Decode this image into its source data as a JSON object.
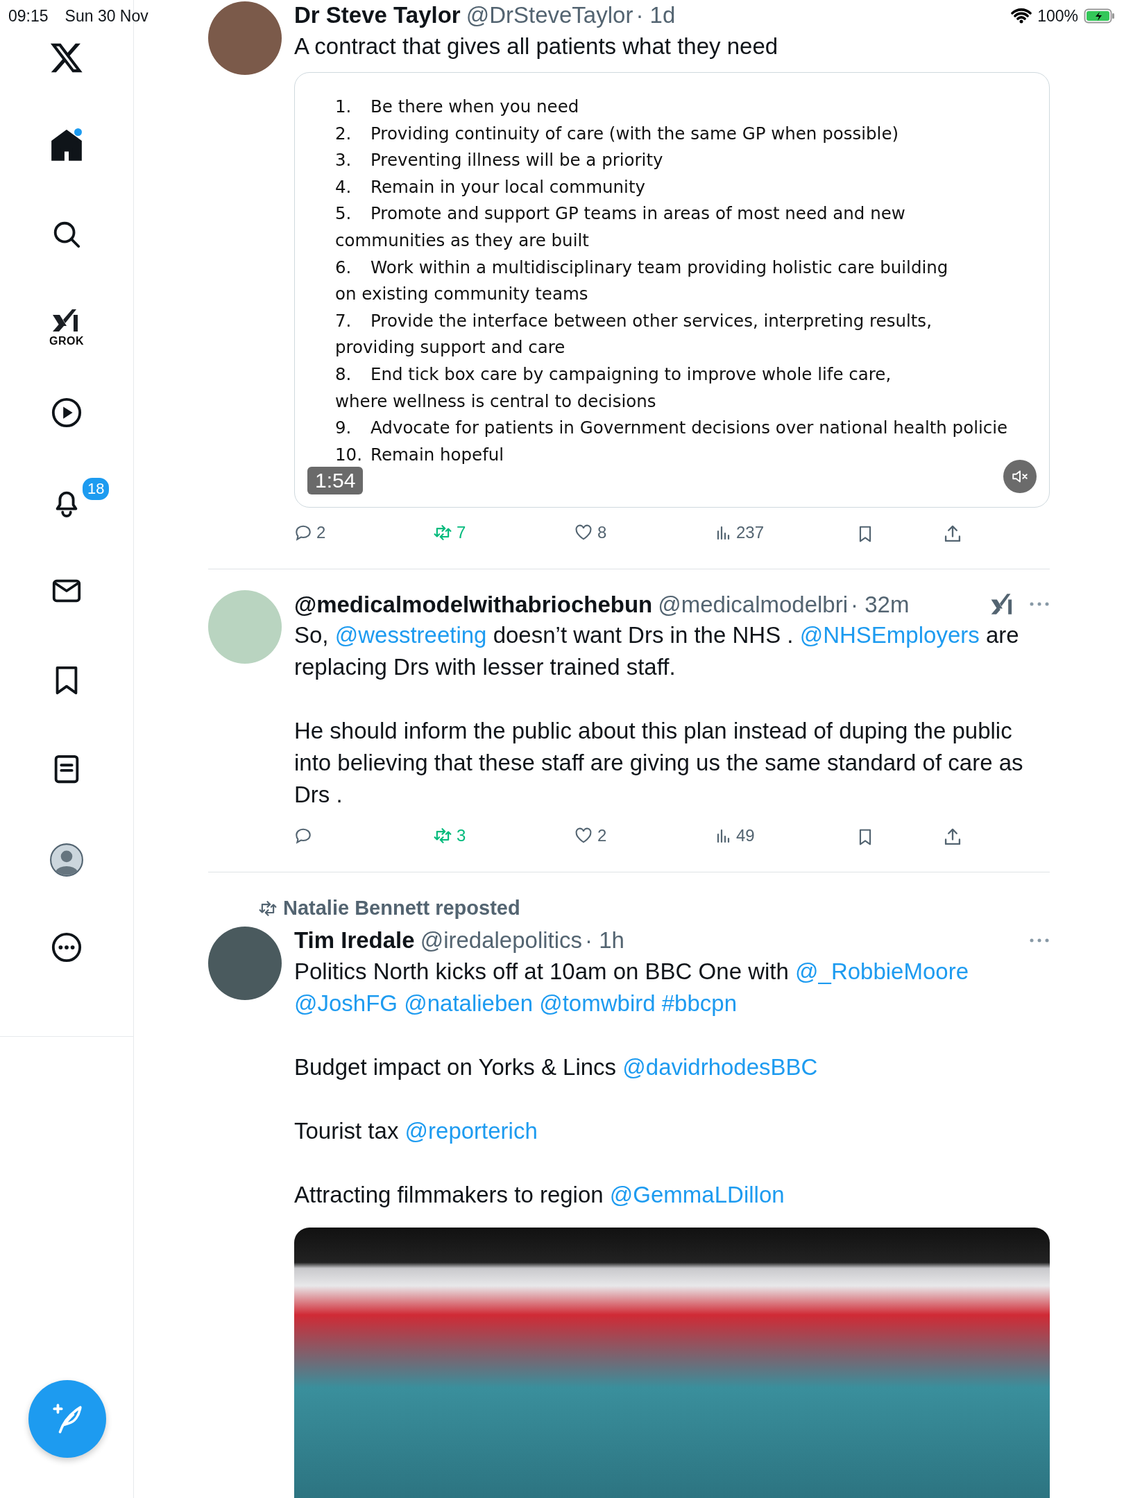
{
  "status_bar": {
    "time": "09:15",
    "date": "Sun 30 Nov",
    "battery": "100%"
  },
  "sidebar": {
    "items": [
      {
        "kind": "logo",
        "selected": false,
        "unread": false
      },
      {
        "kind": "home",
        "selected": true,
        "unread": true
      },
      {
        "kind": "search",
        "selected": false,
        "unread": false
      },
      {
        "kind": "grok",
        "label": "GROK",
        "selected": false,
        "unread": false
      },
      {
        "kind": "video",
        "selected": false,
        "unread": false
      },
      {
        "kind": "notifications",
        "badge": "18",
        "selected": false,
        "unread": false
      },
      {
        "kind": "messages",
        "selected": false,
        "unread": false
      },
      {
        "kind": "bookmarks",
        "selected": false,
        "unread": false
      },
      {
        "kind": "lists",
        "selected": false,
        "unread": false
      },
      {
        "kind": "profile",
        "selected": false,
        "unread": false
      },
      {
        "kind": "more",
        "selected": false,
        "unread": false
      }
    ]
  },
  "tweets": [
    {
      "name": "Dr Steve Taylor",
      "handle": "@DrSteveTaylor",
      "time": "· 1d",
      "grok": false,
      "more": false,
      "paragraphs": [
        [
          {
            "text": "A contract that gives all patients what they need"
          }
        ]
      ],
      "media": {
        "kind": "video",
        "duration": "1:54",
        "muted": true,
        "lines": [
          {
            "num": "1.",
            "text": "Be there when you need"
          },
          {
            "num": "2.",
            "text": "Providing continuity of care (with the same GP when possible)"
          },
          {
            "num": "3.",
            "text": "Preventing illness will be a priority"
          },
          {
            "num": "4.",
            "text": "Remain in your local community"
          },
          {
            "num": "5.",
            "text": "Promote and support GP teams in areas of most need and new",
            "continuation": "communities as they are built"
          },
          {
            "num": "6.",
            "text": "Work within a multidisciplinary team providing holistic care building",
            "continuation": "on existing community teams"
          },
          {
            "num": "7.",
            "text": "Provide the interface between other services, interpreting results,",
            "continuation": "providing support and care"
          },
          {
            "num": "8.",
            "text": "End tick box care by campaigning to improve whole life care,",
            "continuation": "where wellness is central to decisions"
          },
          {
            "num": "9.",
            "text": "Advocate for patients in Government decisions over national health policie"
          },
          {
            "num": "10.",
            "text": "Remain hopeful"
          }
        ]
      },
      "actions": {
        "replies": "2",
        "reposts": "7",
        "likes": "8",
        "views": "237",
        "reposted": true
      }
    },
    {
      "name": "@medicalmodelwithabriochebun",
      "handle": "@medicalmodelbri",
      "time": "· 32m",
      "grok": true,
      "more": true,
      "paragraphs": [
        [
          {
            "text": "So, "
          },
          {
            "text": "@wesstreeting",
            "kind": "link"
          },
          {
            "text": " doesn’t want Drs in the NHS .  "
          },
          {
            "text": "@NHSEmployers",
            "kind": "link"
          },
          {
            "text": " are replacing Drs with lesser trained staff."
          }
        ],
        [
          {
            "text": "He should inform the public about this plan instead of duping the public into believing that these staff are giving us the same standard of care as Drs ."
          }
        ]
      ],
      "actions": {
        "reposts": "3",
        "likes": "2",
        "views": "49",
        "reposted": true
      }
    },
    {
      "repost_by": "Natalie Bennett reposted",
      "name": "Tim Iredale",
      "handle": "@iredalepolitics",
      "time": "· 1h",
      "grok": false,
      "more": true,
      "paragraphs": [
        [
          {
            "text": "Politics North kicks off at 10am on BBC One with "
          },
          {
            "text": "@_RobbieMoore",
            "kind": "link"
          },
          {
            "text": "@JoshFG",
            "kind": "link"
          },
          {
            "text": "@natalieben",
            "kind": "link"
          },
          {
            "text": "@tomwbird",
            "kind": "link"
          },
          {
            "text": "#bbcpn",
            "kind": "link"
          }
        ],
        [
          {
            "text": "Budget impact on Yorks & Lincs "
          },
          {
            "text": "@davidrhodesBBC",
            "kind": "link"
          }
        ],
        [
          {
            "text": "Tourist tax "
          },
          {
            "text": "@reporterich",
            "kind": "link"
          }
        ],
        [
          {
            "text": "Attracting filmmakers to region "
          },
          {
            "text": "@GemmaLDillon",
            "kind": "link"
          }
        ]
      ],
      "media": {
        "kind": "photo"
      }
    }
  ]
}
